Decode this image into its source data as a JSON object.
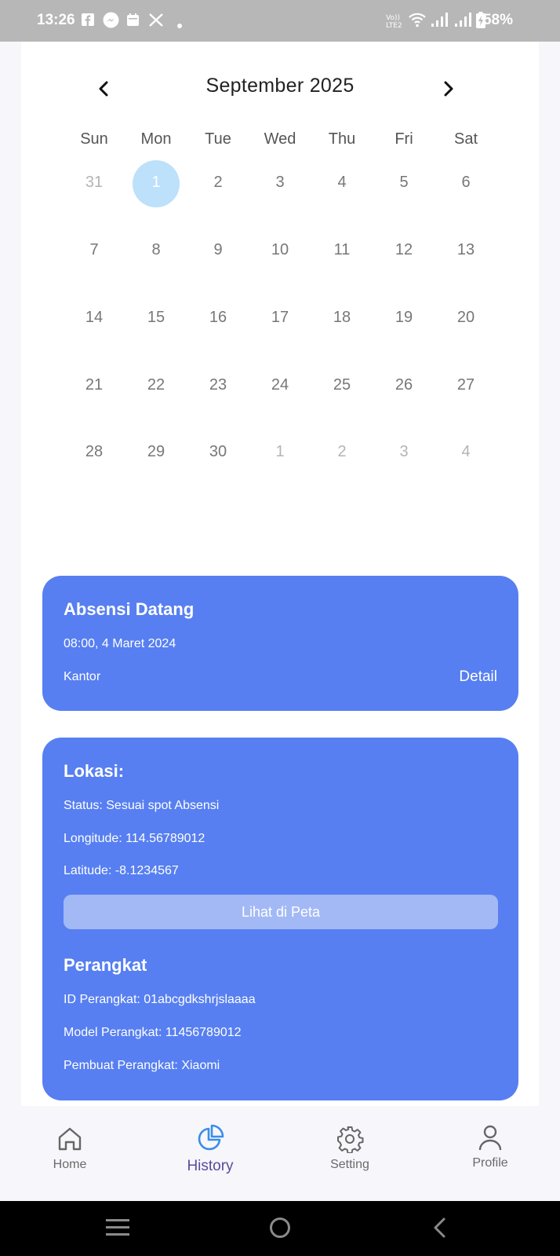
{
  "status_bar": {
    "time": "13:26",
    "battery": "58%",
    "icons": [
      "facebook-icon",
      "messenger-icon",
      "calendar-icon",
      "x-icon",
      "dot-icon",
      "volte-icon",
      "wifi-icon",
      "signal-icon",
      "signal-icon",
      "battery-icon"
    ]
  },
  "calendar": {
    "month_title": "September 2025",
    "weekdays": [
      "Sun",
      "Mon",
      "Tue",
      "Wed",
      "Thu",
      "Fri",
      "Sat"
    ],
    "weeks": [
      [
        "31",
        "1",
        "2",
        "3",
        "4",
        "5",
        "6"
      ],
      [
        "7",
        "8",
        "9",
        "10",
        "11",
        "12",
        "13"
      ],
      [
        "14",
        "15",
        "16",
        "17",
        "18",
        "19",
        "20"
      ],
      [
        "21",
        "22",
        "23",
        "24",
        "25",
        "26",
        "27"
      ],
      [
        "28",
        "29",
        "30",
        "1",
        "2",
        "3",
        "4"
      ]
    ],
    "selected_day": "1",
    "selected_color": "#bde0fb"
  },
  "attendance_card": {
    "title": "Absensi Datang",
    "datetime": "08:00, 4 Maret 2024",
    "place": "Kantor",
    "detail_label": "Detail"
  },
  "location_card": {
    "title": "Lokasi:",
    "status": "Status: Sesuai spot Absensi",
    "longitude": "Longitude: 114.56789012",
    "latitude": "Latitude: -8.1234567",
    "map_button": "Lihat di Peta",
    "device_title": "Perangkat",
    "device_id": "ID Perangkat: 01abcgdkshrjslaaaa",
    "device_model": "Model Perangkat: 11456789012",
    "device_maker": "Pembuat Perangkat: Xiaomi"
  },
  "bottom_nav": {
    "home": "Home",
    "history": "History",
    "setting": "Setting",
    "profile": "Profile",
    "active": "History"
  },
  "colors": {
    "card": "#577ff1",
    "accent": "#3a8ee6"
  }
}
